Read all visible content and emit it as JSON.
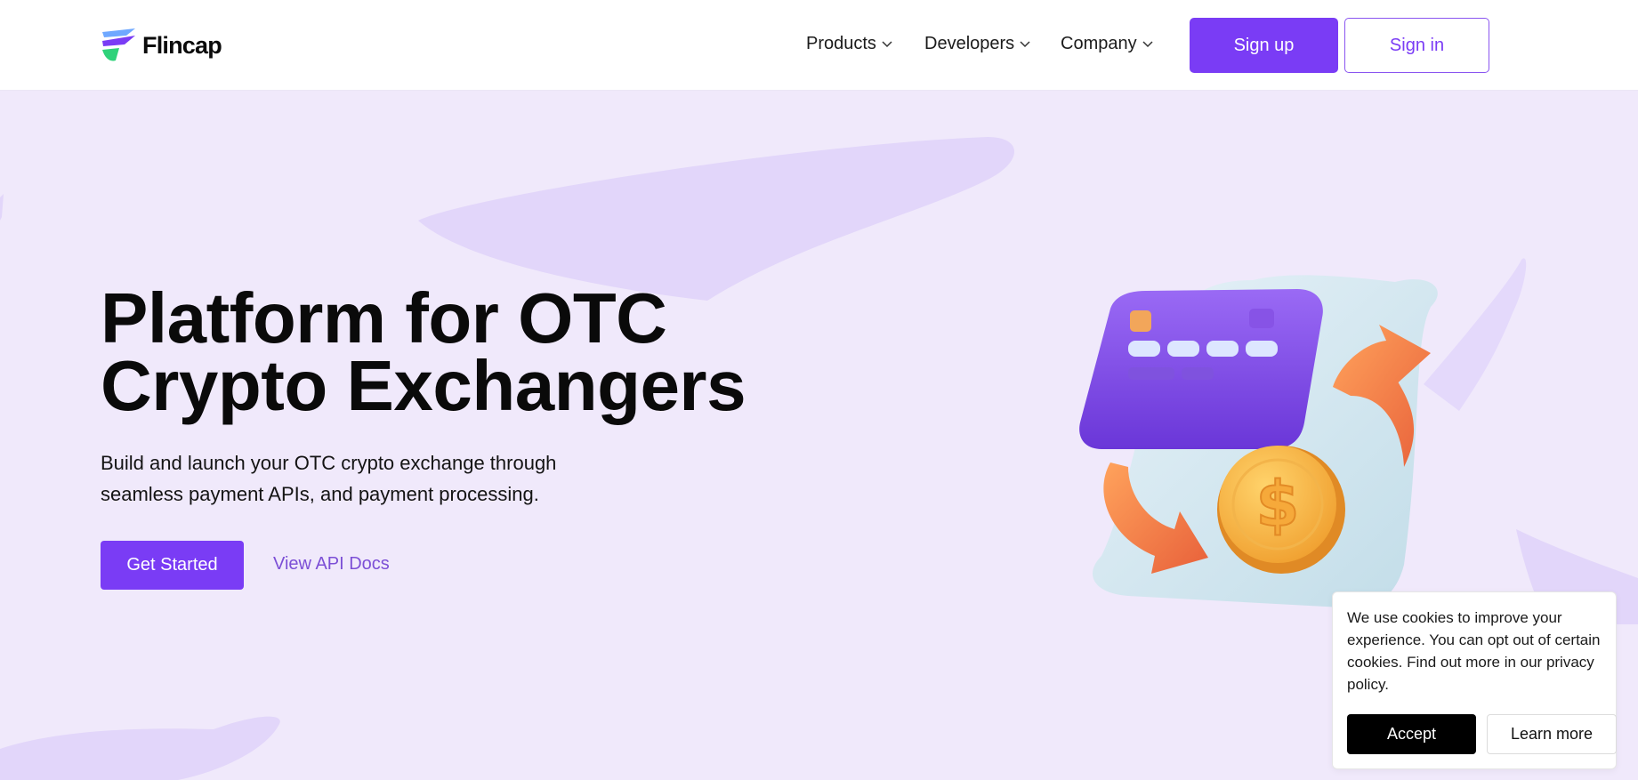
{
  "brand": {
    "name": "Flincap",
    "accent": "#7a3cf5",
    "background": "#f0e9fb"
  },
  "nav": {
    "products": "Products",
    "developers": "Developers",
    "company": "Company",
    "signup": "Sign up",
    "signin": "Sign in"
  },
  "hero": {
    "title_line1": "Platform for OTC",
    "title_line2": "Crypto Exchangers",
    "subtitle_line1": "Build and launch your OTC crypto exchange through",
    "subtitle_line2": "seamless payment APIs, and payment processing.",
    "cta_primary": "Get Started",
    "cta_secondary": "View API Docs",
    "illustration": "card-coin-exchange-illustration"
  },
  "cookie": {
    "text": "We use cookies to improve your experience. You can opt out of certain cookies. Find out more in our privacy policy.",
    "accept": "Accept",
    "learn_more": "Learn more"
  }
}
